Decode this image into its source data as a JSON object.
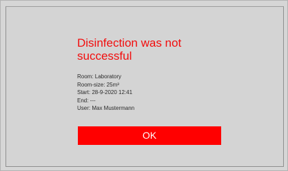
{
  "dialog": {
    "title": "Disinfection was not successful",
    "details": [
      "Room: Laboratory",
      "Room-size: 25m³",
      "Start: 28-9-2020 12:41",
      "End: ---",
      "User: Max Mustermann"
    ],
    "ok_label": "OK"
  },
  "colors": {
    "background": "#d4d4d4",
    "title_red": "#f20d0d",
    "button_red": "#ff0000",
    "button_text": "#ffffff"
  }
}
